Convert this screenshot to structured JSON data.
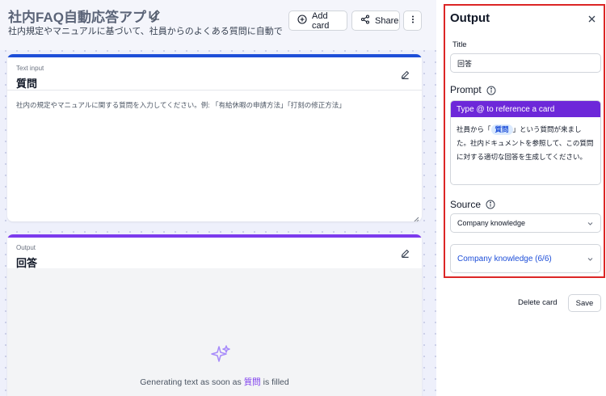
{
  "app": {
    "title": "社内FAQ自動応答アプリ",
    "description": "社内規定やマニュアルに基づいて、社員からのよくある質問に自動で回答..."
  },
  "toolbar": {
    "add_card_label": "Add card",
    "share_label": "Share"
  },
  "input_card": {
    "type_label": "Text input",
    "name": "質問",
    "placeholder": "社内の規定やマニュアルに関する質問を入力してください。例: 「有給休暇の申請方法」「打刻の修正方法」",
    "accent_color": "#1d4ed8"
  },
  "output_card": {
    "type_label": "Output",
    "name": "回答",
    "status_prefix": "Generating text as soon as",
    "status_ref": "質問",
    "status_suffix": "is filled",
    "accent_color": "#7c3aed"
  },
  "panel": {
    "title": "Output",
    "title_field_label": "Title",
    "title_field_value": "回答",
    "prompt_label": "Prompt",
    "prompt_hint": "Type @ to reference a card",
    "prompt_text_before": "社員から「",
    "prompt_chip": "質問",
    "prompt_text_after": "」という質問が来ました。社内ドキュメントを参照して、この質問に対する適切な回答を生成してください。",
    "source_label": "Source",
    "source_value": "Company knowledge",
    "knowledge_value": "Company knowledge (6/6)",
    "delete_label": "Delete card",
    "save_label": "Save"
  }
}
